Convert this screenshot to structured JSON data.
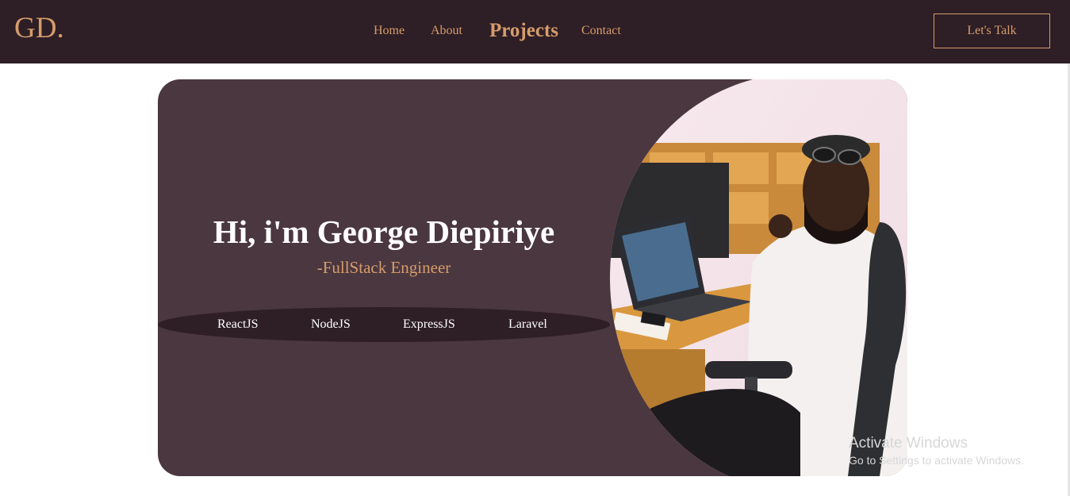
{
  "nav": {
    "logo": "GD.",
    "links": [
      {
        "label": "Home"
      },
      {
        "label": "About"
      },
      {
        "label": "Projects",
        "active": true
      },
      {
        "label": "Contact"
      }
    ],
    "cta_label": "Let's Talk"
  },
  "hero": {
    "title": "Hi, i'm George Diepiriye",
    "subtitle": "-FullStack Engineer",
    "skills": [
      "ReactJS",
      "NodeJS",
      "ExpressJS",
      "Laravel"
    ],
    "photo_description": "developer portrait"
  },
  "watermark": {
    "title": "Activate Windows",
    "subtitle": "Go to Settings to activate Windows."
  },
  "colors": {
    "nav_bg": "#2e1e25",
    "accent": "#d59d6b",
    "hero_bg": "#4b3740",
    "skill_bg": "#2e1e25"
  }
}
